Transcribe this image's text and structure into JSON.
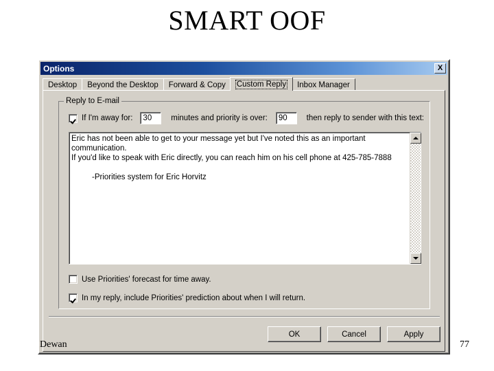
{
  "slide": {
    "title": "SMART OOF",
    "footer": "Dewan",
    "page_number": "77"
  },
  "dialog": {
    "titlebar": {
      "title": "Options",
      "close_label": "X"
    },
    "tabs": [
      {
        "label": "Desktop",
        "selected": false
      },
      {
        "label": "Beyond the Desktop",
        "selected": false
      },
      {
        "label": "Forward & Copy",
        "selected": false
      },
      {
        "label": "Custom Reply",
        "selected": true
      },
      {
        "label": "Inbox Manager",
        "selected": false
      }
    ],
    "group": {
      "legend": "Reply to E-mail",
      "away_rule": {
        "checkbox_checked": true,
        "prefix_label": "If I'm away for:",
        "minutes_value": "30",
        "middle_label": "minutes and priority is over:",
        "priority_value": "90",
        "suffix_label": "then reply to sender with this text:"
      },
      "reply_text": {
        "line1": "Eric has not been able to get to your message yet but I've noted this as an important communication.",
        "line2": "If you'd like to speak with Eric directly, you can reach him on his cell phone at 425-785-7888",
        "line3": "-Priorities system for Eric Horvitz"
      },
      "options": [
        {
          "label": "Use Priorities' forecast for time away.",
          "checked": false
        },
        {
          "label": "In my reply, include Priorities' prediction about when I will return.",
          "checked": true
        }
      ]
    },
    "buttons": [
      {
        "label": "OK"
      },
      {
        "label": "Cancel"
      },
      {
        "label": "Apply"
      }
    ],
    "colors": {
      "face": "#d4d0c8",
      "titlebar_start": "#0a246a",
      "titlebar_end": "#a6caf0"
    }
  }
}
